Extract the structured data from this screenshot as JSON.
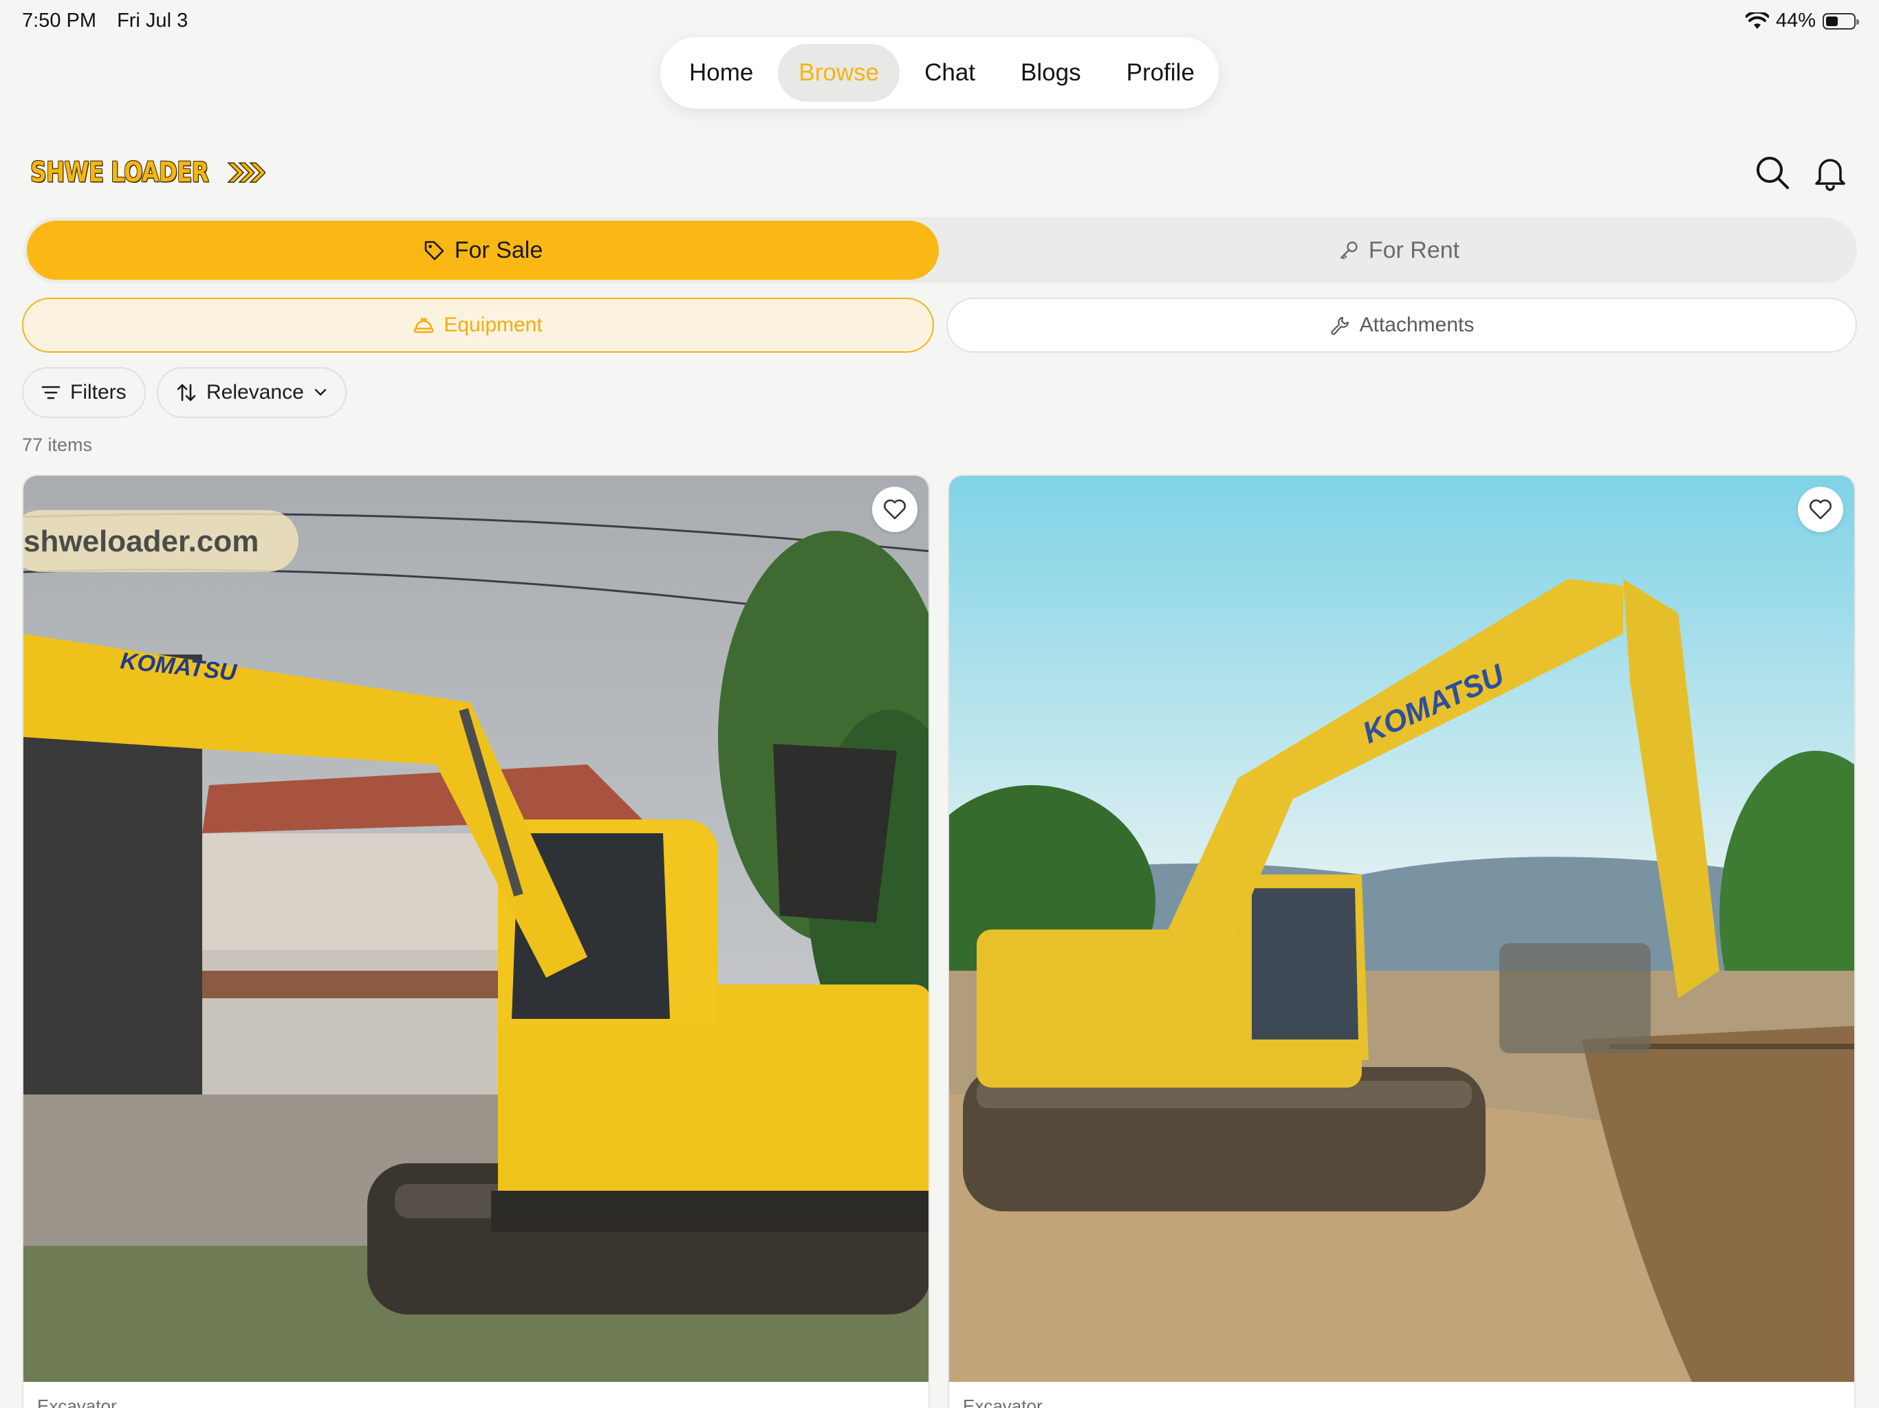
{
  "status": {
    "time": "7:50 PM",
    "date": "Fri Jul 3",
    "battery": "44%",
    "battery_level": 0.44,
    "icons": [
      "wifi-icon",
      "battery-icon"
    ]
  },
  "nav": {
    "items": [
      {
        "label": "Home"
      },
      {
        "label": "Browse",
        "active": true
      },
      {
        "label": "Chat"
      },
      {
        "label": "Blogs"
      },
      {
        "label": "Profile"
      }
    ]
  },
  "header": {
    "logo_text": "SHWE LOADER",
    "icons": [
      "search-icon",
      "bell-icon"
    ]
  },
  "listing_type": {
    "sale_label": "For Sale",
    "rent_label": "For Rent",
    "selected": "For Sale"
  },
  "category": {
    "equipment_label": "Equipment",
    "attachments_label": "Attachments",
    "selected": "Equipment"
  },
  "toolbar": {
    "filters_label": "Filters",
    "sort_label": "Relevance"
  },
  "results": {
    "count_text": "77 items"
  },
  "listings": [
    {
      "category": "Excavator",
      "watermark": "shweloader.com",
      "brand_mark": "KOMATSU"
    },
    {
      "category": "Excavator",
      "brand_mark": "KOMATSU"
    }
  ],
  "colors": {
    "accent": "#fbb815",
    "accent_text": "#f5b40f",
    "background": "#f5f5f3"
  }
}
